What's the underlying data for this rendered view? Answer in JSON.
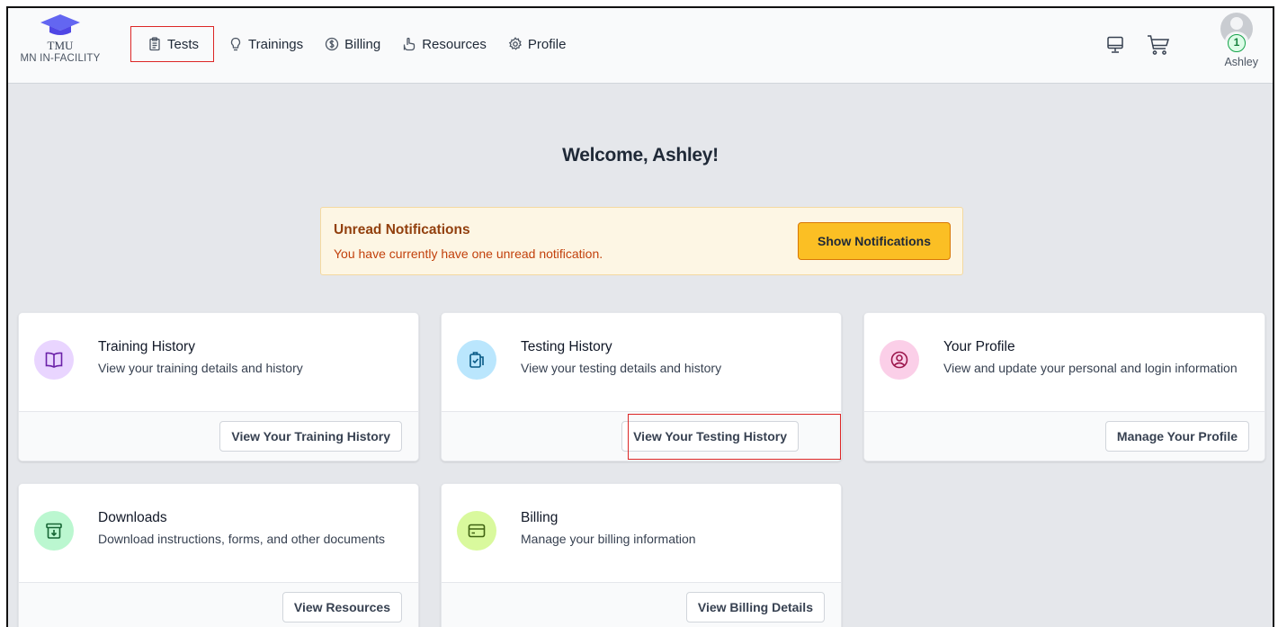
{
  "brand": {
    "name": "TMU",
    "subtitle": "MN IN-FACILITY"
  },
  "nav": {
    "items": [
      {
        "label": "Tests",
        "icon": "clipboard-icon"
      },
      {
        "label": "Trainings",
        "icon": "lightbulb-icon"
      },
      {
        "label": "Billing",
        "icon": "dollar-circle-icon"
      },
      {
        "label": "Resources",
        "icon": "hand-pointer-icon"
      },
      {
        "label": "Profile",
        "icon": "gear-icon"
      }
    ]
  },
  "header": {
    "user_name": "Ashley",
    "notification_count": "1"
  },
  "welcome": "Welcome, Ashley!",
  "notification": {
    "title": "Unread Notifications",
    "text": "You have currently have one unread notification.",
    "button": "Show Notifications"
  },
  "cards": [
    {
      "title": "Training History",
      "desc": "View your training details and history",
      "button": "View Your Training History",
      "icon": "book-icon",
      "color": "#e9d5ff"
    },
    {
      "title": "Testing History",
      "desc": "View your testing details and history",
      "button": "View Your Testing History",
      "icon": "clipboard-check-icon",
      "color": "#bae6fd"
    },
    {
      "title": "Your Profile",
      "desc": "View and update your personal and login information",
      "button": "Manage Your Profile",
      "icon": "user-circle-icon",
      "color": "#fbcfe8"
    },
    {
      "title": "Downloads",
      "desc": "Download instructions, forms, and other documents",
      "button": "View Resources",
      "icon": "archive-download-icon",
      "color": "#bbf7d0"
    },
    {
      "title": "Billing",
      "desc": "Manage your billing information",
      "button": "View Billing Details",
      "icon": "credit-card-icon",
      "color": "#d9f99d"
    }
  ]
}
